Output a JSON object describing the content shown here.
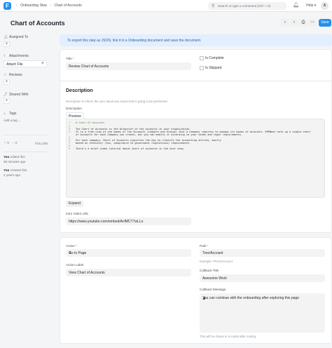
{
  "navbar": {
    "logo": "F",
    "breadcrumbs": [
      "Onboarding Step",
      "Chart of Accounts"
    ],
    "search_placeholder": "Search or type a command (Ctrl + G)",
    "help_label": "Help",
    "avatar_initial": "A"
  },
  "page": {
    "title": "Chart of Accounts",
    "save_label": "Save"
  },
  "sidebar": {
    "assigned_to": "Assigned To",
    "attachments": "Attachments",
    "attach_file": "Attach File",
    "reviews": "Reviews",
    "shared_with": "Shared With",
    "tags": "Tags",
    "add_tag": "Add a tag ...",
    "like_count": "0",
    "comment_count": "0",
    "follow": "FOLLOW",
    "edited_by": "You",
    "edited_text": " edited this",
    "edited_time": "28 minutes ago",
    "created_by": "You",
    "created_text": " created this",
    "created_time": "2 years ago"
  },
  "alert": {
    "text": "To export this step as JSON, link it in a Onboarding document and save the document."
  },
  "form": {
    "title_label": "Title",
    "title_value": "Review Chart of Accounts",
    "is_complete": "Is Complete",
    "is_skipped": "Is Skipped",
    "description_heading": "Description",
    "description_help": "Description to inform the user about any action that is going to be performed",
    "description_label": "Description",
    "preview_tab": "Preview",
    "code_lines": [
      "# Chart Of Accounts",
      "",
      "The Chart of Accounts is the blueprint of the accounts in your organization.",
      "It is a tree view of the names of the Accounts (Ledgers and Groups) that a Company requires to manage its books of accounts. ERPNext sets up a simple chart",
      "of accounts for each Company you create, but you can modify it according to your needs and legal requirements.",
      "",
      "For each company, Chart of Accounts signifies the way to classify the accounting entries, mostly",
      "based on statutory (tax, compliance to government regulations) requirements.",
      "",
      "There's a brief video tutorial about chart of accounts in the next step."
    ],
    "line_numbers": [
      "1",
      "2",
      "3",
      "4",
      "",
      "5",
      "6",
      "7",
      "8",
      "9"
    ],
    "expand_label": "Expand",
    "intro_video_label": "Intro Video URL",
    "intro_video_value": "https://www.youtube.com/embed/AcfMCT7wLLo",
    "action_label": "Action",
    "action_value": "Go to Page",
    "action_label_label": "Action Label",
    "action_label_value": "View Chart of Accounts",
    "path_label": "Path",
    "path_value": "Tree/Account",
    "path_help": "Example: #Tree/Account",
    "callback_title_label": "Callback Title",
    "callback_title_value": "Awesome Work",
    "callback_message_label": "Callback Message",
    "callback_message_value": "You can continue with the onboarding after exploring this page",
    "callback_help": "This will be shown in a modal after routing"
  },
  "colors": {
    "primary": "#2490ef",
    "alert_bg": "#e1efff",
    "required": "#e24c4c"
  }
}
